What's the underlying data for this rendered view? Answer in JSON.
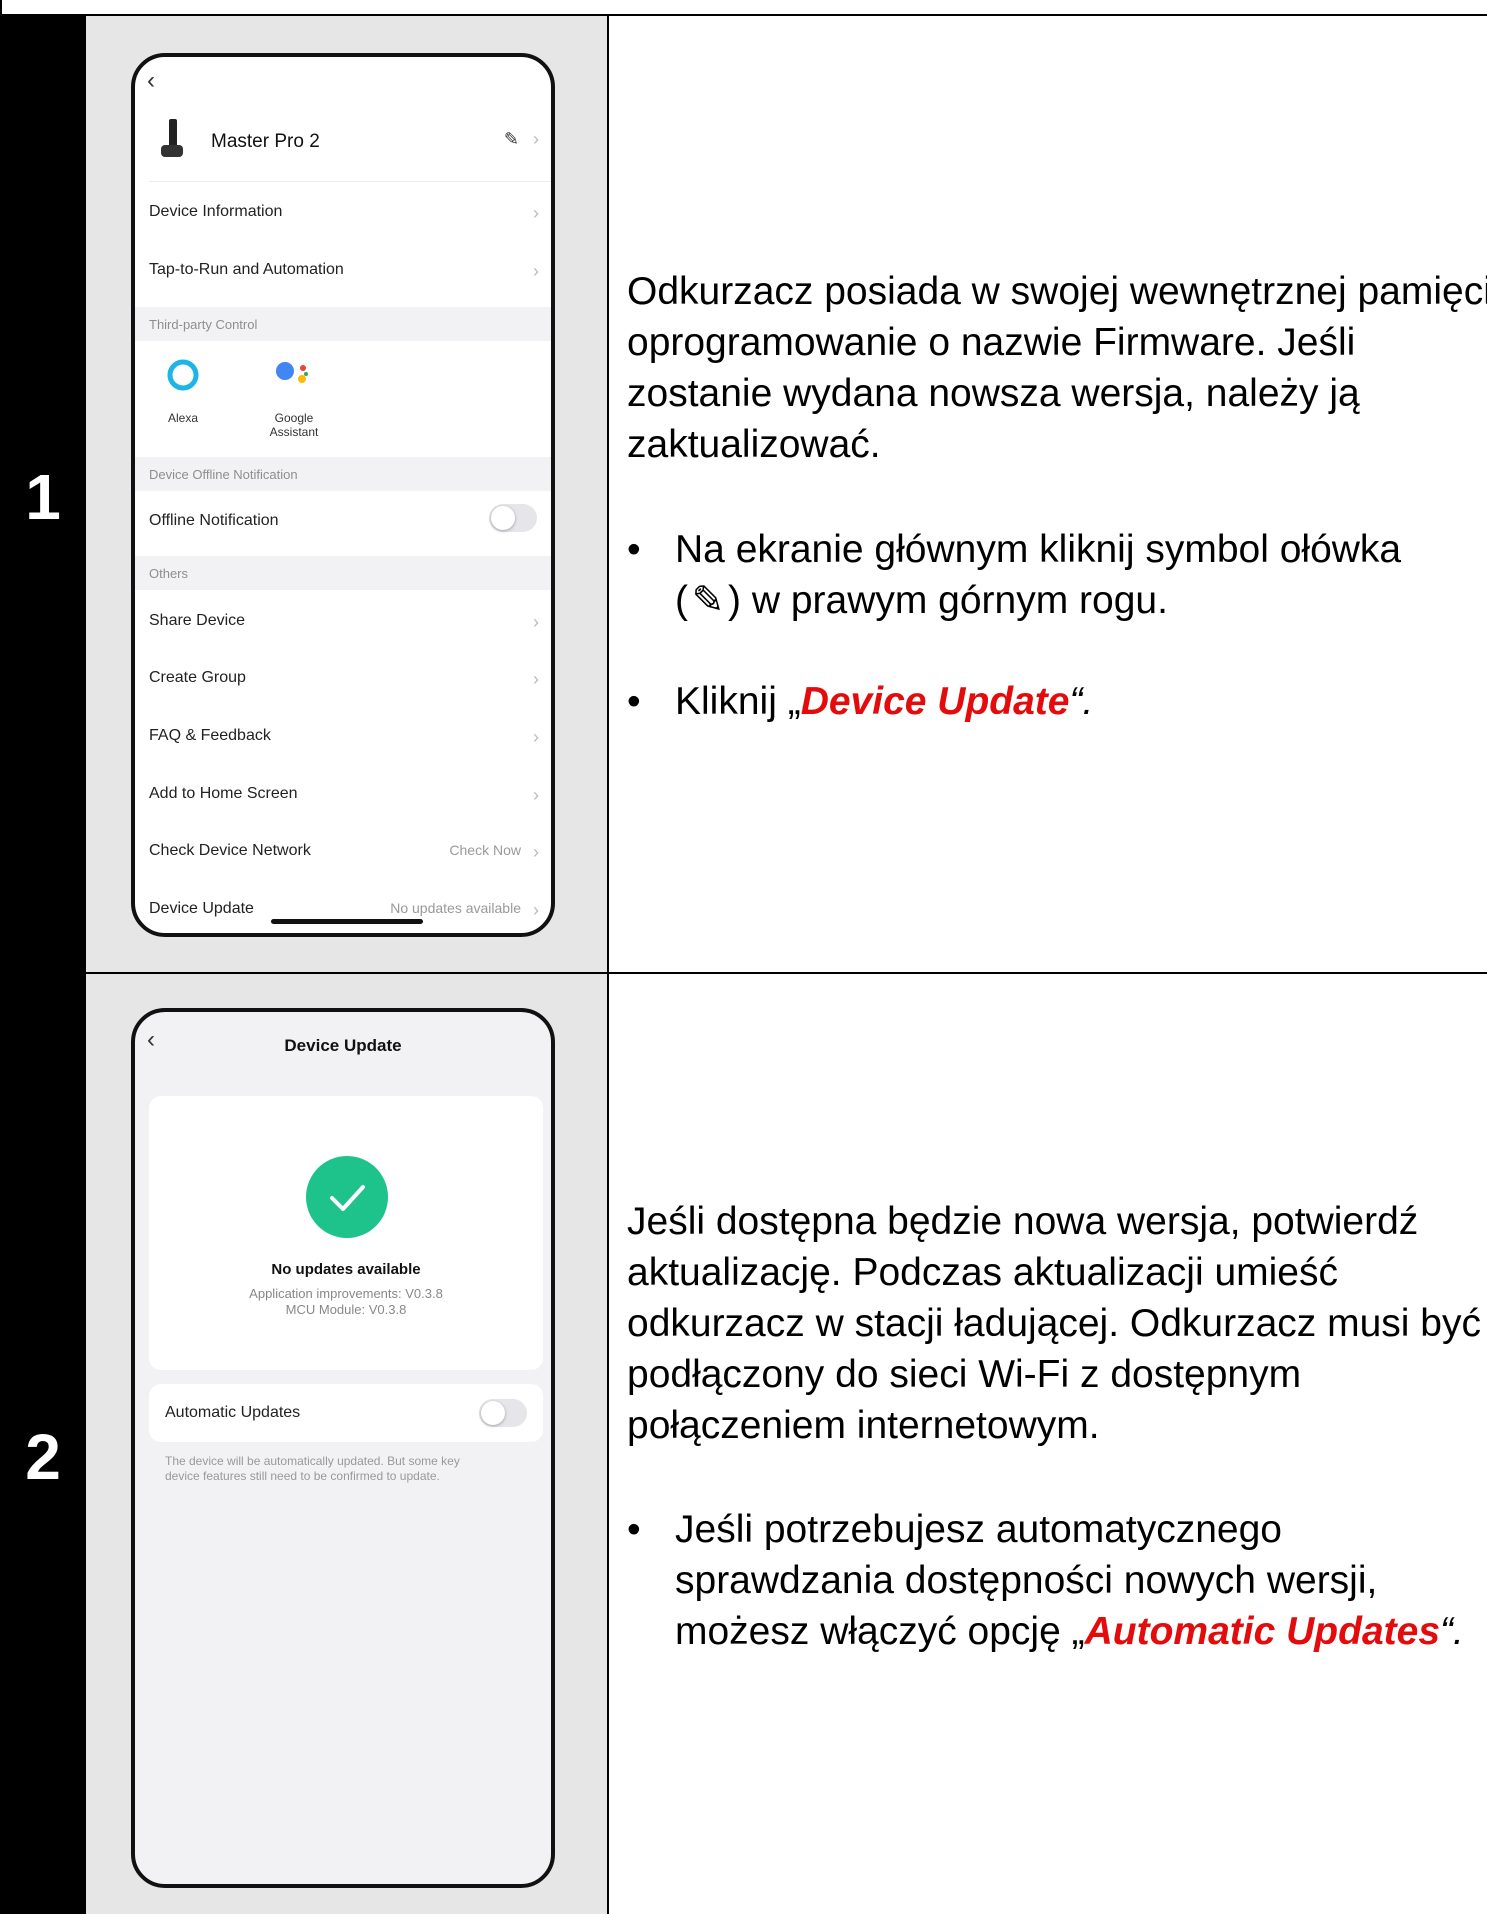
{
  "steps": [
    {
      "number": "1",
      "paragraph": "Odkurzacz posiada w swojej wewnętrznej pamięci oprogramowanie o nazwie Firmware. Jeśli zostanie wydana nowsza wersja, należy ją zaktualizować.",
      "bullet1_line1": "Na ekranie głównym kliknij symbol ołówka",
      "bullet1_line2_pre": "(",
      "bullet1_line2_post": ") w prawym górnym rogu.",
      "bullet2_pre": "Kliknij „",
      "bullet2_highlight": "Device Update",
      "bullet2_post": "“."
    },
    {
      "number": "2",
      "paragraph": "Jeśli dostępna będzie nowa wersja, potwierdź aktualizację. Podczas aktualizacji umieść odkurzacz w stacji ładującej. Odkurzacz musi być podłączony do sieci Wi-Fi z dostępnym połączeniem internetowym.",
      "bullet_pre": "Jeśli potrzebujesz automatycznego sprawdzania dostępności nowych wersji, możesz włączyć opcję „",
      "bullet_highlight": "Automatic Updates",
      "bullet_post": "“."
    }
  ],
  "screen1": {
    "device_name": "Master Pro 2",
    "items": {
      "device_information": "Device Information",
      "tap_to_run": "Tap-to-Run and Automation",
      "third_party_section": "Third-party Control",
      "alexa": "Alexa",
      "google_line1": "Google",
      "google_line2": "Assistant",
      "offline_section": "Device Offline Notification",
      "offline_notification": "Offline Notification",
      "others_section": "Others",
      "share_device": "Share Device",
      "create_group": "Create Group",
      "faq": "FAQ & Feedback",
      "add_home": "Add to Home Screen",
      "check_network": "Check Device Network",
      "check_now": "Check Now",
      "device_update": "Device Update",
      "no_updates": "No updates available"
    }
  },
  "screen2": {
    "title": "Device Update",
    "status": "No updates available",
    "app_version": "Application improvements: V0.3.8",
    "mcu_version": "MCU Module: V0.3.8",
    "auto_updates": "Automatic Updates",
    "note_line1": "The device will be automatically updated. But some key",
    "note_line2": "device features still need to be confirmed to update."
  },
  "colors": {
    "highlight": "#e30b0b",
    "success": "#1ec28b"
  }
}
